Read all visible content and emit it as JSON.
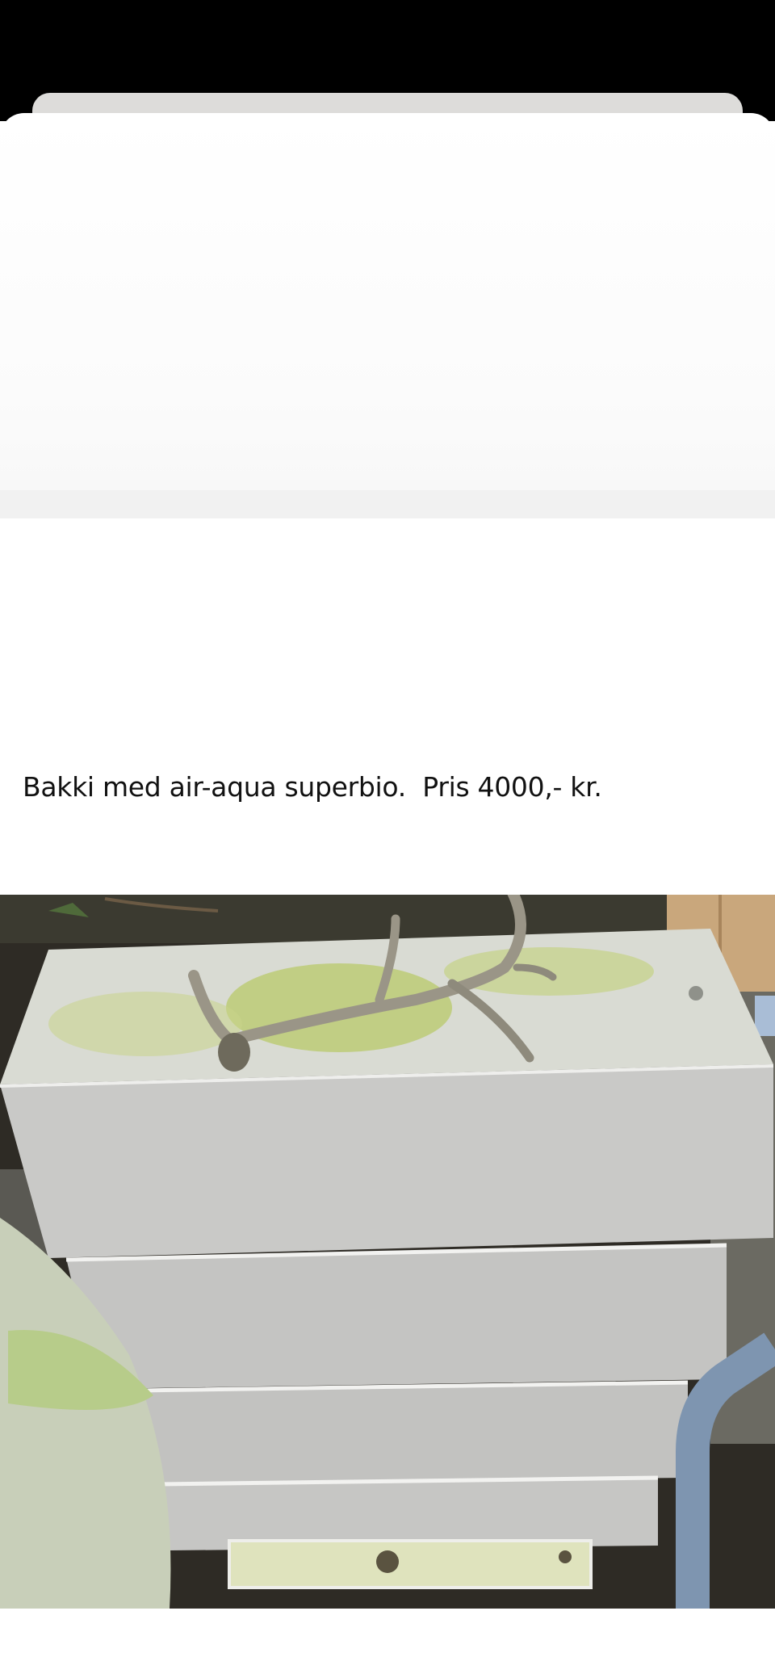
{
  "post": {
    "text": "Bakki med air-aqua superbio.  Pris 4000,- kr."
  },
  "photo": {
    "subject": "stacked grey filter boxes with an antler on top",
    "colors": {
      "box": "#c8c8c6",
      "box_top": "#d8d9d2",
      "algae": "#b6c86a",
      "pipe": "#7e95b0",
      "ground": "#2e2b25"
    }
  }
}
